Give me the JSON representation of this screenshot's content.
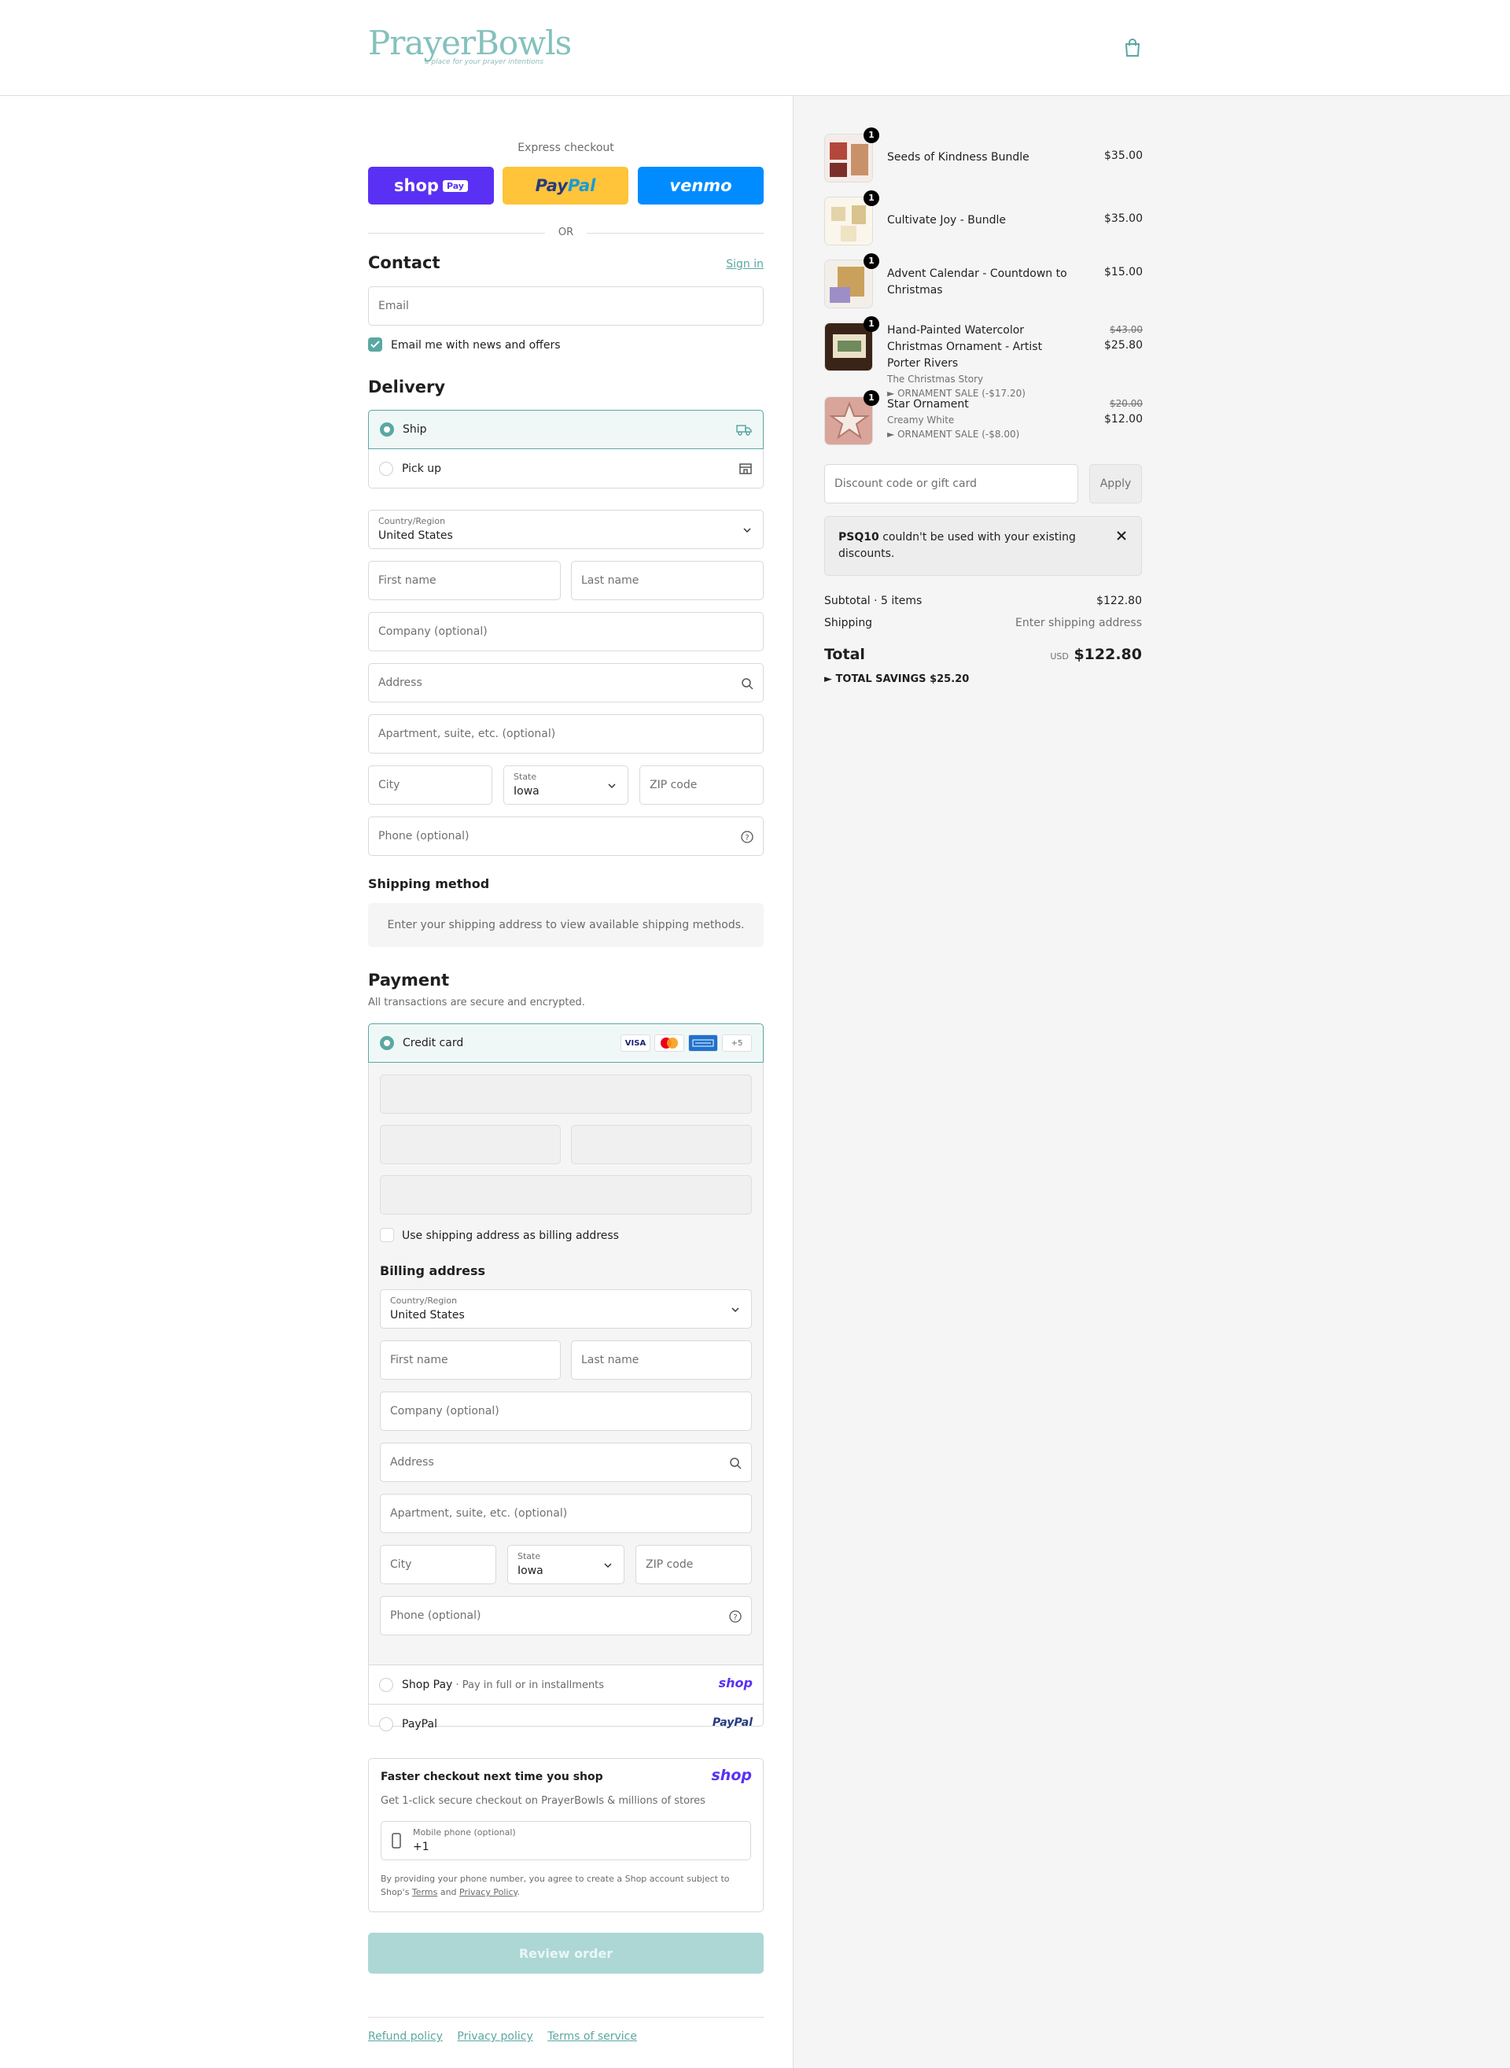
{
  "brand": {
    "name_a": "Prayer",
    "name_b": "Bowls",
    "tagline": "a place for your prayer intentions",
    "accent": "#5aa8a2"
  },
  "express": {
    "title": "Express checkout",
    "shop_label": "shop",
    "shop_pay": "Pay",
    "paypal_a": "Pay",
    "paypal_b": "Pal",
    "venmo": "venmo",
    "or": "OR"
  },
  "contact": {
    "title": "Contact",
    "sign_in": "Sign in",
    "email_placeholder": "Email",
    "news_label": "Email me with news and offers"
  },
  "delivery": {
    "title": "Delivery",
    "ship": "Ship",
    "pickup": "Pick up",
    "country_label": "Country/Region",
    "country": "United States",
    "first_name": "First name",
    "last_name": "Last name",
    "company": "Company (optional)",
    "address": "Address",
    "apartment": "Apartment, suite, etc. (optional)",
    "city": "City",
    "state_label": "State",
    "state": "Iowa",
    "zip": "ZIP code",
    "phone": "Phone (optional)"
  },
  "shipping_method": {
    "title": "Shipping method",
    "message": "Enter your shipping address to view available shipping methods."
  },
  "payment": {
    "title": "Payment",
    "subtitle": "All transactions are secure and encrypted.",
    "credit_card": "Credit card",
    "card_visa": "VISA",
    "card_more": "+5",
    "use_shipping": "Use shipping address as billing address",
    "billing_title": "Billing address",
    "shop_pay": "Shop Pay",
    "shop_pay_sub": "Pay in full or in installments",
    "shop_logo": "shop",
    "paypal": "PayPal",
    "paypal_logo": "PayPal"
  },
  "billing": {
    "country_label": "Country/Region",
    "country": "United States",
    "first_name": "First name",
    "last_name": "Last name",
    "company": "Company (optional)",
    "address": "Address",
    "apartment": "Apartment, suite, etc. (optional)",
    "city": "City",
    "state_label": "State",
    "state": "Iowa",
    "zip": "ZIP code",
    "phone": "Phone (optional)"
  },
  "shop_promo": {
    "title": "Faster checkout next time you shop",
    "logo": "shop",
    "subtitle": "Get 1-click secure checkout on PrayerBowls & millions of stores",
    "phone_label": "Mobile phone (optional)",
    "phone_value": "+1",
    "legal_a": "By providing your phone number, you agree to create a Shop account subject to",
    "legal_b": "Shop's",
    "terms": "Terms",
    "and": "and",
    "privacy": "Privacy Policy",
    "dot": "."
  },
  "review_button": "Review order",
  "footer": {
    "refund": "Refund policy",
    "privacy": "Privacy policy",
    "terms": "Terms of service"
  },
  "cart": {
    "items": [
      {
        "name": "Seeds of Kindness Bundle",
        "qty": "1",
        "price": "$35.00"
      },
      {
        "name": "Cultivate Joy - Bundle",
        "qty": "1",
        "price": "$35.00"
      },
      {
        "name": "Advent Calendar - Countdown to Christmas",
        "qty": "1",
        "price": "$15.00"
      },
      {
        "name": "Hand-Painted Watercolor Christmas Ornament - Artist Porter Rivers",
        "variant": "The Christmas Story",
        "discount": "ORNAMENT SALE (-$17.20)",
        "qty": "1",
        "old_price": "$43.00",
        "price": "$25.80"
      },
      {
        "name": "Star Ornament",
        "variant": "Creamy White",
        "discount": "ORNAMENT SALE (-$8.00)",
        "qty": "1",
        "old_price": "$20.00",
        "price": "$12.00"
      }
    ],
    "discount_placeholder": "Discount code or gift card",
    "apply": "Apply",
    "alert_code": "PSQ10",
    "alert_text": "couldn't be used with your existing discounts.",
    "subtotal_label": "Subtotal · 5 items",
    "subtotal": "$122.80",
    "shipping_label": "Shipping",
    "shipping_value": "Enter shipping address",
    "total_label": "Total",
    "currency": "USD",
    "total": "$122.80",
    "savings_label": "TOTAL SAVINGS",
    "savings": "$25.20"
  }
}
